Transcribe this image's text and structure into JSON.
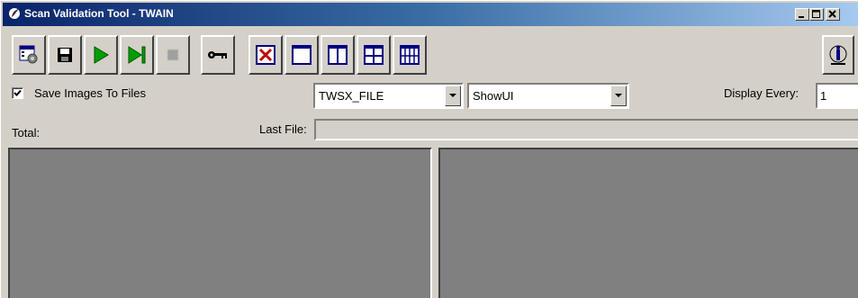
{
  "window": {
    "title": "Scan Validation Tool - TWAIN",
    "titlebar_gradient": [
      "#0a246a",
      "#a6caf0"
    ],
    "caption_buttons": [
      "minimize",
      "maximize",
      "close"
    ]
  },
  "toolbar": {
    "buttons": [
      {
        "name": "settings-button",
        "icon": "settings-icon"
      },
      {
        "name": "save-button",
        "icon": "floppy-disk-icon"
      },
      {
        "name": "start-scan-button",
        "icon": "play-icon"
      },
      {
        "name": "scan-one-button",
        "icon": "play-step-icon"
      },
      {
        "name": "stop-button",
        "icon": "stop-icon"
      },
      {
        "name": "license-key-button",
        "icon": "key-icon"
      },
      {
        "name": "no-images-view-button",
        "icon": "x-box-icon"
      },
      {
        "name": "one-image-view-button",
        "icon": "single-pane-icon"
      },
      {
        "name": "two-images-view-button",
        "icon": "two-pane-icon"
      },
      {
        "name": "four-images-view-button",
        "icon": "four-pane-icon"
      },
      {
        "name": "eight-images-view-button",
        "icon": "eight-pane-icon"
      },
      {
        "name": "about-button",
        "icon": "info-person-icon"
      }
    ]
  },
  "options": {
    "save_images_label": "Save Images To Files",
    "save_images_checked": true,
    "file_format_value": "TWSX_FILE",
    "ui_mode_value": "ShowUI",
    "display_every_label": "Display Every:",
    "display_every_value": "1"
  },
  "status": {
    "total_label": "Total:",
    "last_file_label": "Last File:",
    "last_file_value": ""
  },
  "colors": {
    "face": "#d4d0c8",
    "pane": "#808080",
    "play_green": "#00a000",
    "close_red": "#c00000",
    "view_blue": "#000080"
  }
}
